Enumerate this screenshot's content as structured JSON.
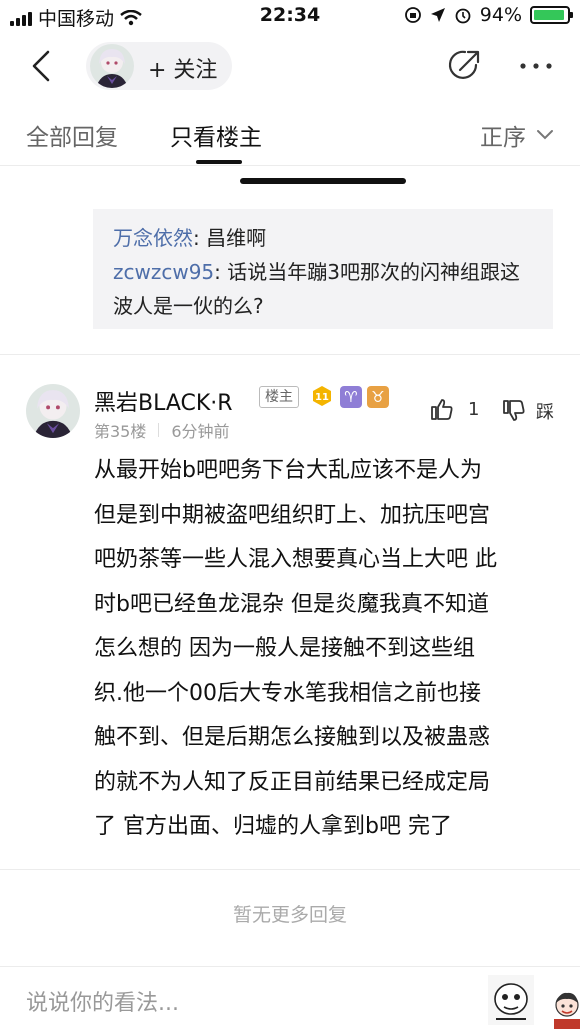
{
  "status_bar": {
    "carrier": "中国移动",
    "time": "22:34",
    "battery": "94%",
    "battery_level": 0.94
  },
  "header": {
    "follow_label": "+ 关注"
  },
  "tabs": {
    "all_replies": "全部回复",
    "only_op": "只看楼主",
    "sort": "正序"
  },
  "sub_replies": [
    {
      "name": "万念依然",
      "sep": ": ",
      "text": "昌维啊"
    },
    {
      "name": "zcwzcw95",
      "sep": ": ",
      "text": "话说当年蹦3吧那次的闪神组跟这波人是一伙的么?"
    }
  ],
  "post": {
    "author": "黑岩BLACK·R",
    "op_badge": "楼主",
    "level": "11",
    "zodiac_1": "♈",
    "zodiac_2": "♉",
    "floor": "第35楼",
    "time_ago": "6分钟前",
    "like_count": "1",
    "dislike_label": "踩",
    "body": "从最开始b吧吧务下台大乱应该不是人为\n但是到中期被盗吧组织盯上、加抗压吧宫\n吧奶茶等一些人混入想要真心当上大吧 此\n时b吧已经鱼龙混杂 但是炎魔我真不知道\n怎么想的 因为一般人是接触不到这些组\n织.他一个00后大专水笔我相信之前也接\n触不到、但是后期怎么接触到以及被蛊惑\n的就不为人知了反正目前结果已经成定局\n了 官方出面、归墟的人拿到b吧 完了"
  },
  "footer": {
    "no_more": "暂无更多回复",
    "input_placeholder": "说说你的看法..."
  },
  "colors": {
    "link_blue": "#4e6ea9",
    "battery_green": "#34c759",
    "level_gold": "#f4b400"
  }
}
